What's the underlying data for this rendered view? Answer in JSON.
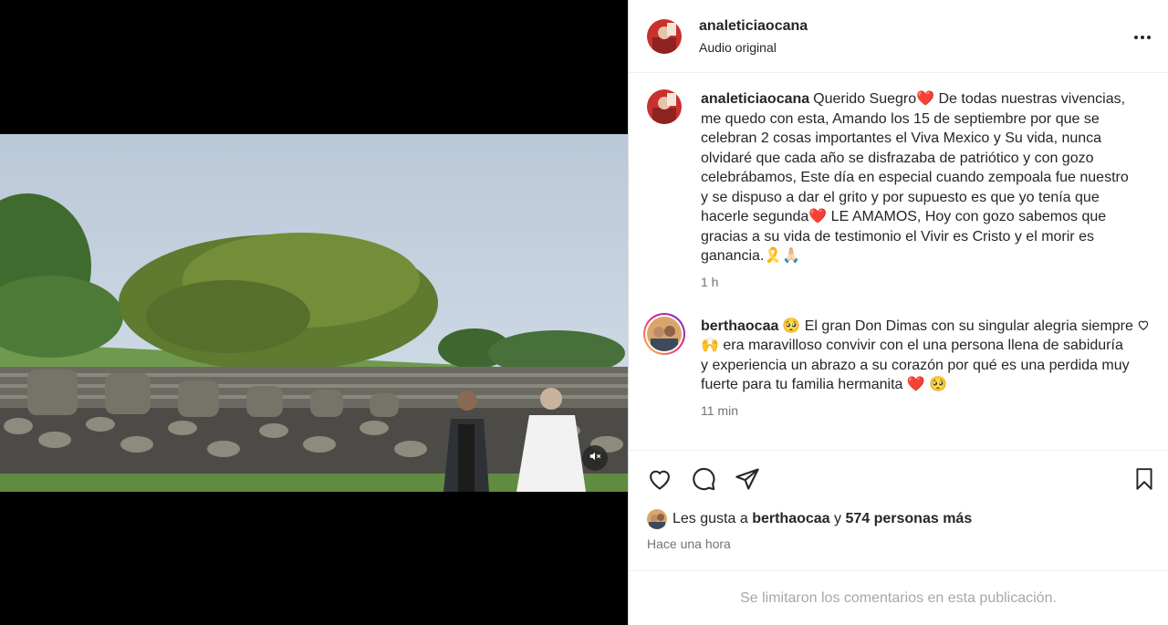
{
  "header": {
    "username": "analeticiaocana",
    "subtitle": "Audio original"
  },
  "caption": {
    "username": "analeticiaocana",
    "text": "Querido Suegro❤️ De todas nuestras vivencias, me quedo con esta, Amando los 15 de septiembre por que se celebran 2 cosas importantes el Viva Mexico y Su vida, nunca olvidaré que cada año se disfrazaba de patriótico y con gozo celebrábamos, Este día en especial cuando zempoala fue nuestro y se dispuso a dar el grito y por supuesto es que yo tenía que hacerle segunda❤️ LE AMAMOS, Hoy con gozo sabemos que gracias a su vida de testimonio el Vivir es Cristo y el morir es ganancia.🎗️🙏🏻",
    "time": "1 h"
  },
  "comment": {
    "username": "berthaocaa",
    "text": "🥺 El gran Don Dimas con su singular alegria siempre 🙌 era maravilloso convivir con el una persona llena de sabiduría y experiencia un abrazo a su corazón por qué es una perdida muy fuerte para tu familia hermanita ❤️ 🥺",
    "time": "11 min"
  },
  "likes": {
    "prefix": "Les gusta a",
    "user": "berthaocaa",
    "connector": "y",
    "others": "574 personas más"
  },
  "posted": "Hace una hora",
  "footer": "Se limitaron los comentarios en esta publicación.",
  "icons": {
    "more": "more-options-icon",
    "like": "heart-icon",
    "comment": "comment-bubble-icon",
    "share": "paper-plane-icon",
    "save": "bookmark-icon",
    "mute": "speaker-muted-icon"
  },
  "colors": {
    "text": "#262626",
    "secondary": "#737373",
    "muted": "#a8a8a8",
    "border": "#efefef"
  }
}
